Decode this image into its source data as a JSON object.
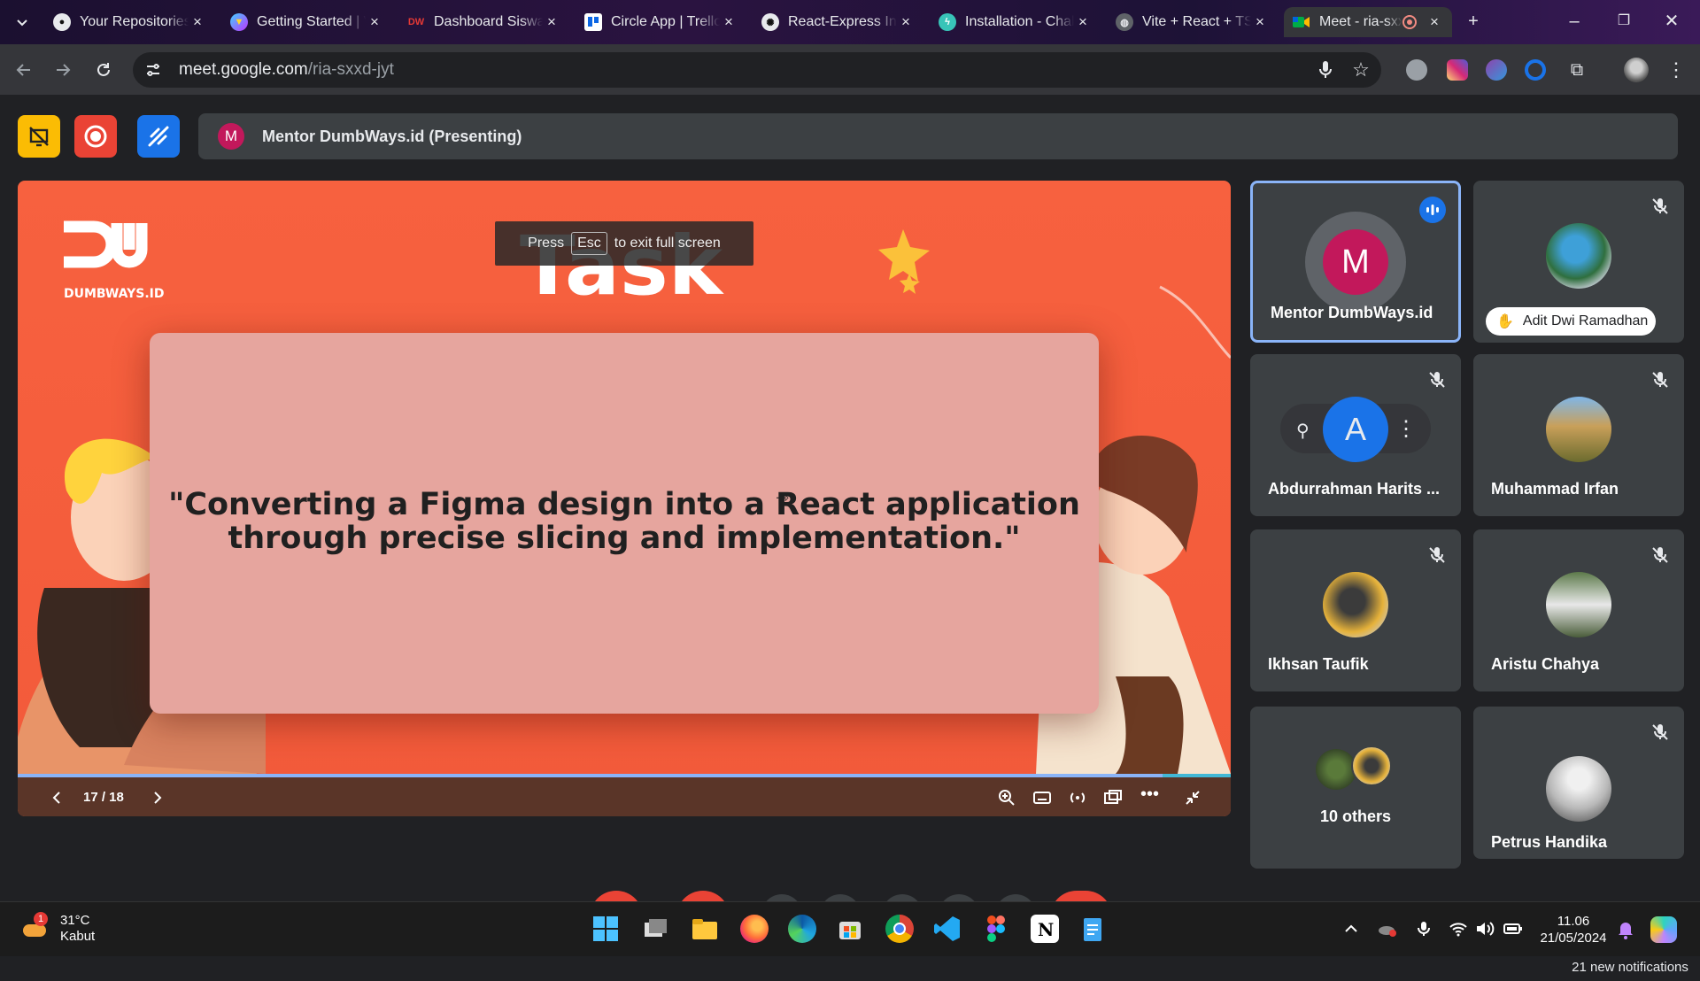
{
  "browser": {
    "tabs": [
      {
        "title": "Your Repositories",
        "icon": "github-icon",
        "active": false
      },
      {
        "title": "Getting Started | Vite",
        "icon": "vite-icon",
        "active": false
      },
      {
        "title": "Dashboard Siswa",
        "icon": "dumbways-icon",
        "active": false
      },
      {
        "title": "Circle App | Trello",
        "icon": "trello-icon",
        "active": false
      },
      {
        "title": "React-Express Integration",
        "icon": "openai-icon",
        "active": false
      },
      {
        "title": "Installation - Chakra UI",
        "icon": "chakra-icon",
        "active": false
      },
      {
        "title": "Vite + React + TS",
        "icon": "globe-icon",
        "active": false
      },
      {
        "title": "Meet - ria-sxxd-jyt",
        "icon": "meet-icon",
        "active": true
      }
    ],
    "address": {
      "host": "meet.google.com",
      "path": "/ria-sxxd-jyt"
    }
  },
  "meet": {
    "presenting_banner": {
      "avatar_letter": "M",
      "text": "Mentor DumbWays.id (Presenting)"
    },
    "slide": {
      "esc_hint": {
        "press": "Press",
        "key": "Esc",
        "rest": "to exit full screen"
      },
      "heading": "Task",
      "logo_caption": "DUMBWAYS.ID",
      "quote_line1": "\"Converting a Figma design into a React application",
      "quote_line2": "through precise slicing and implementation.\"",
      "page_indicator": "17 / 18",
      "progress_fraction": 0.944
    },
    "participants": [
      {
        "name": "Mentor DumbWays.id",
        "avatar_letter": "M",
        "speaking": true,
        "muted": false
      },
      {
        "name": "Adit Dwi Ramadhan",
        "muted": true,
        "raised_hand": true
      },
      {
        "name": "Abdurrahman Harits ...",
        "avatar_letter": "A",
        "muted": true,
        "hovered": true
      },
      {
        "name": "Muhammad Irfan",
        "muted": true
      },
      {
        "name": "Ikhsan Taufik",
        "muted": true
      },
      {
        "name": "Aristu Chahya",
        "muted": true
      },
      {
        "name": "10 others"
      },
      {
        "name": "Petrus Handika",
        "muted": true
      }
    ],
    "notification": "21 new notifications"
  },
  "taskbar": {
    "weather": {
      "temp": "31°C",
      "condition": "Kabut",
      "badge": "1"
    },
    "clock": {
      "time": "11.06",
      "date": "21/05/2024"
    }
  },
  "colors": {
    "accent": "#8ab4f8",
    "slide_bg": "#f25a3a",
    "quote_bg": "#e6a59e",
    "avatar_m": "#c2185b"
  }
}
